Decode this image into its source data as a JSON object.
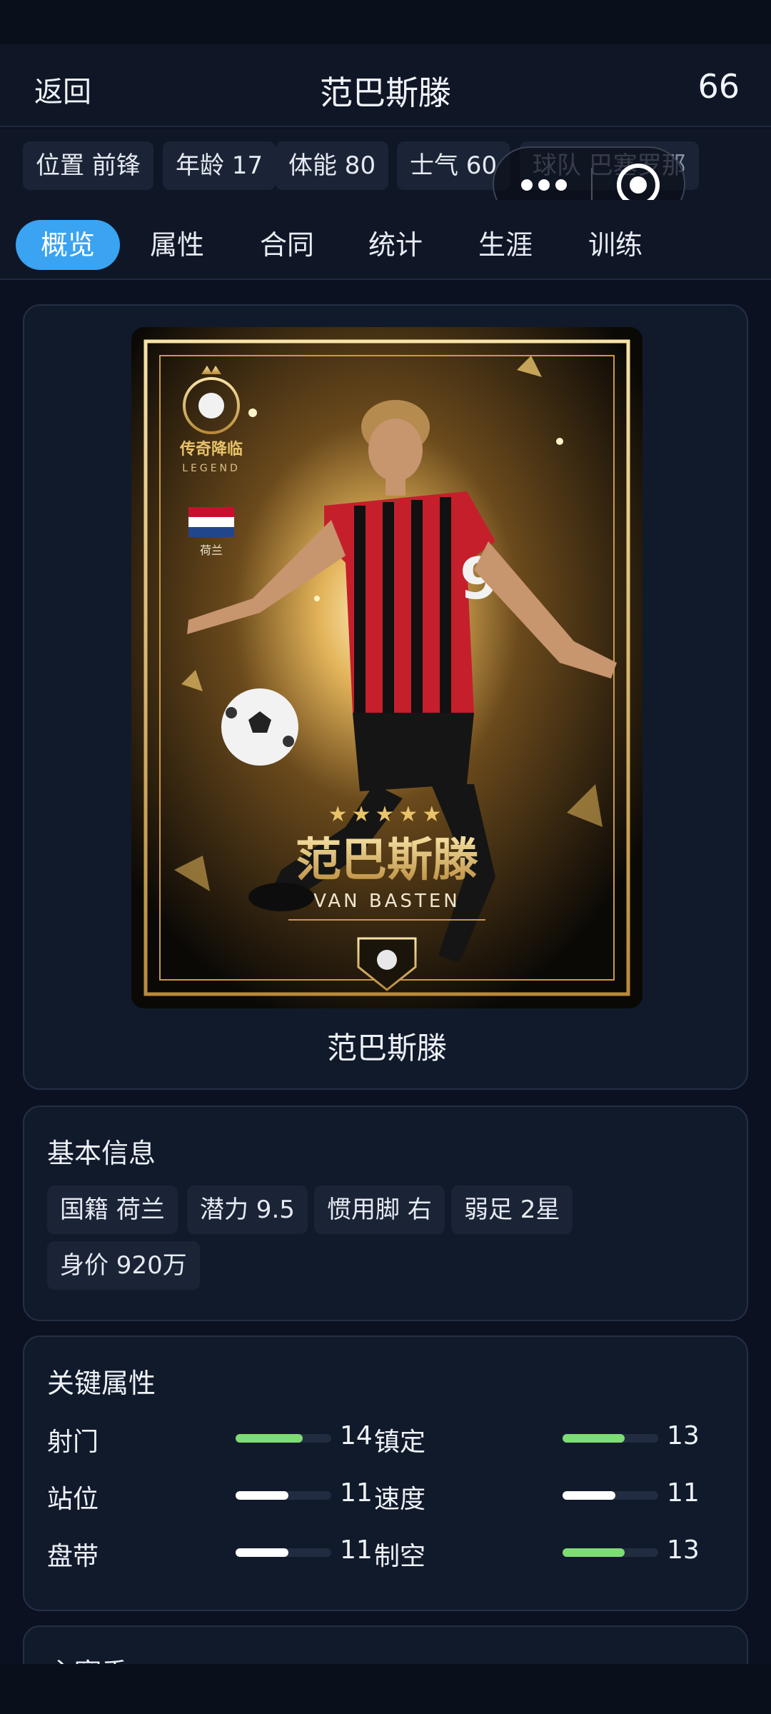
{
  "nav": {
    "back_label": "返回",
    "title": "范巴斯滕",
    "rating": "66"
  },
  "chips": [
    "位置 前锋",
    "年龄 17",
    "体能 80",
    "士气 60",
    "球队 巴塞罗那"
  ],
  "tabs": [
    "概览",
    "属性",
    "合同",
    "统计",
    "生涯",
    "训练"
  ],
  "hero": {
    "caption": "范巴斯滕",
    "card_art": {
      "badge_cn": "传奇降临",
      "badge_en": "LEGEND",
      "nation": "荷兰",
      "stars": "★★★★★",
      "name_cn": "范巴斯滕",
      "name_en": "VAN BASTEN",
      "shirt_number": "9"
    }
  },
  "basic_info": {
    "title": "基本信息",
    "items": [
      "国籍 荷兰",
      "潜力 9.5",
      "惯用脚 右",
      "弱足 2星",
      "身价 920万"
    ]
  },
  "key_attrs": {
    "title": "关键属性",
    "items": [
      {
        "label": "射门",
        "value": 14,
        "fill": 0.7,
        "color": "#7ddc74"
      },
      {
        "label": "镇定",
        "value": 13,
        "fill": 0.65,
        "color": "#7ddc74"
      },
      {
        "label": "站位",
        "value": 11,
        "fill": 0.55,
        "color": "#ffffff"
      },
      {
        "label": "速度",
        "value": 11,
        "fill": 0.55,
        "color": "#ffffff"
      },
      {
        "label": "盘带",
        "value": 11,
        "fill": 0.55,
        "color": "#ffffff"
      },
      {
        "label": "制空",
        "value": 13,
        "fill": 0.65,
        "color": "#7ddc74"
      }
    ]
  },
  "next_section": {
    "title": "主赛季"
  },
  "colors": {
    "accent": "#3aa3f2",
    "good": "#7ddc74",
    "background": "#0b1120",
    "card": "#111a2b"
  }
}
